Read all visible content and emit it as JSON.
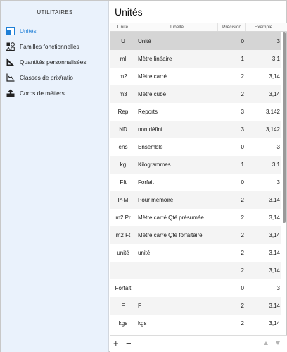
{
  "sidebar": {
    "title": "UTILITAIRES",
    "items": [
      {
        "label": "Unités",
        "icon": "units-icon",
        "active": true
      },
      {
        "label": "Familles fonctionnelles",
        "icon": "shapes-icon",
        "active": false
      },
      {
        "label": "Quantités personnalisées",
        "icon": "ruler-icon",
        "active": false
      },
      {
        "label": "Classes de prix/ratio",
        "icon": "chart-icon",
        "active": false
      },
      {
        "label": "Corps de métiers",
        "icon": "tray-icon",
        "active": false
      }
    ]
  },
  "main": {
    "title": "Unités",
    "columns": [
      "Unité",
      "Libellé",
      "Précision",
      "Exemple"
    ],
    "rows": [
      {
        "unit": "U",
        "label": "Unité",
        "precision": "0",
        "example": "3",
        "selected": true
      },
      {
        "unit": "ml",
        "label": "Mètre linéaire",
        "precision": "1",
        "example": "3,1"
      },
      {
        "unit": "m2",
        "label": "Mètre carré",
        "precision": "2",
        "example": "3,14"
      },
      {
        "unit": "m3",
        "label": "Mètre cube",
        "precision": "2",
        "example": "3,14"
      },
      {
        "unit": "Rep",
        "label": "Reports",
        "precision": "3",
        "example": "3,142"
      },
      {
        "unit": "ND",
        "label": "non défini",
        "precision": "3",
        "example": "3,142"
      },
      {
        "unit": "ens",
        "label": "Ensemble",
        "precision": "0",
        "example": "3"
      },
      {
        "unit": "kg",
        "label": "Kilogrammes",
        "precision": "1",
        "example": "3,1"
      },
      {
        "unit": "Fft",
        "label": "Forfait",
        "precision": "0",
        "example": "3"
      },
      {
        "unit": "P-M",
        "label": "Pour mémoire",
        "precision": "2",
        "example": "3,14"
      },
      {
        "unit": "m2 Pr",
        "label": "Mètre carré Qté présumée",
        "precision": "2",
        "example": "3,14"
      },
      {
        "unit": "m2 Ft",
        "label": "Mètre carré Qté forfaitaire",
        "precision": "2",
        "example": "3,14"
      },
      {
        "unit": "unité",
        "label": "unité",
        "precision": "2",
        "example": "3,14"
      },
      {
        "unit": "",
        "label": "",
        "precision": "2",
        "example": "3,14"
      },
      {
        "unit": "Forfait",
        "label": "",
        "precision": "0",
        "example": "3"
      },
      {
        "unit": "F",
        "label": "F",
        "precision": "2",
        "example": "3,14"
      },
      {
        "unit": "kgs",
        "label": "kgs",
        "precision": "2",
        "example": "3,14"
      }
    ]
  },
  "footer": {
    "add_label": "+",
    "remove_label": "−"
  }
}
